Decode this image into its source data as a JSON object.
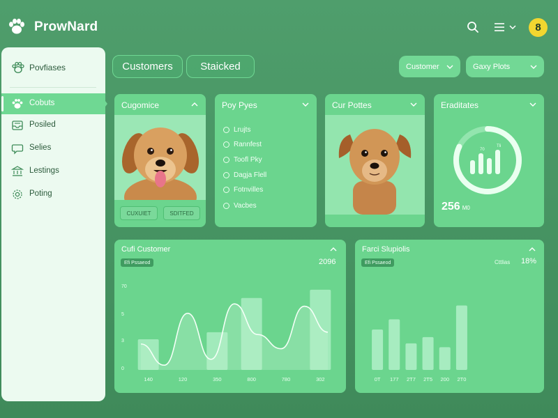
{
  "brand": {
    "name": "ProwNard",
    "logo_icon": "paw-icon"
  },
  "header": {
    "badge": "8",
    "search_icon": "search-icon",
    "menu_icon": "menu-icon"
  },
  "sidebar": {
    "header_label": "Povfiases",
    "items": [
      {
        "label": "Cobuts",
        "icon": "paw-icon",
        "active": true
      },
      {
        "label": "Posiled",
        "icon": "inbox-icon",
        "active": false
      },
      {
        "label": "Selies",
        "icon": "chat-icon",
        "active": false
      },
      {
        "label": "Lestings",
        "icon": "bank-icon",
        "active": false
      },
      {
        "label": "Poting",
        "icon": "gear-icon",
        "active": false
      }
    ]
  },
  "tabs": [
    {
      "label": "Customers"
    },
    {
      "label": "Staicked"
    }
  ],
  "filters": {
    "customer": "Customer",
    "plots": "Gaxy Plots"
  },
  "cards": {
    "customer_card": {
      "title": "Cugomice",
      "buttons": [
        "CUXUIET",
        "SDITFED"
      ]
    },
    "pay_card": {
      "title": "Poy Pyes",
      "items": [
        "Lrujts",
        "Rannfest",
        "Toofl Pky",
        "Dagja Flell",
        "Fotnvilles",
        "Vacbes"
      ]
    },
    "cur_card": {
      "title": "Cur Pottes"
    },
    "stat_card": {
      "title": "Eraditates",
      "value": "256",
      "unit": "M0",
      "gauge_labels": [
        "70",
        "Tli"
      ],
      "gauge_fraction": 0.82
    }
  },
  "charts": {
    "left": {
      "title": "Cufi Customer",
      "chip": "Efi Pssaeod",
      "value": "2096"
    },
    "right": {
      "title": "Farci Slupiolis",
      "chip": "Efi Pssaeod",
      "value_label": "Cttlias",
      "value": "18%"
    }
  },
  "chart_data": [
    {
      "type": "bar",
      "title": "Cufi Customer",
      "categories": [
        "140",
        "120",
        "350",
        "800",
        "780",
        "302"
      ],
      "y_ticks": [
        "70",
        "5",
        "3",
        "0"
      ],
      "bar_values": [
        2.6,
        0,
        3.2,
        6.1,
        0,
        6.8
      ],
      "line_values": [
        2.2,
        0.4,
        4.8,
        0.9,
        5.6,
        3.0,
        1.8,
        5.4,
        3.2
      ],
      "ylim": [
        0,
        7.5
      ]
    },
    {
      "type": "bar",
      "title": "Farci Slupiolis",
      "categories": [
        "0T",
        "177",
        "2T7",
        "2T5",
        "200",
        "2T0"
      ],
      "values": [
        3.2,
        4.0,
        2.1,
        2.6,
        1.8,
        5.1
      ],
      "ylim": [
        0,
        7
      ]
    }
  ],
  "colors": {
    "background": "#4f9e6c",
    "card": "#6bd58e",
    "accent": "#72d895",
    "sidebar": "#ecfaf0",
    "badge": "#f2d630"
  }
}
